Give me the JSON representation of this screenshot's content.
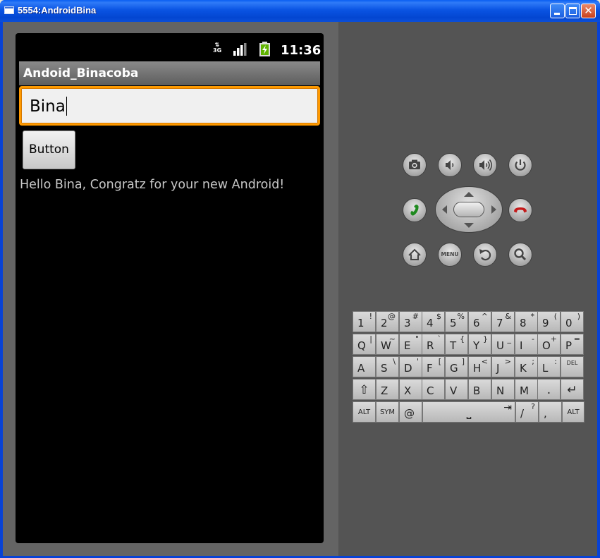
{
  "window": {
    "title": "5554:AndroidBina",
    "minimize_icon": "minimize-icon",
    "maximize_icon": "maximize-icon",
    "close_icon": "close-icon",
    "close_glyph": "✕"
  },
  "status_bar": {
    "network_type": "3G",
    "time": "11:36"
  },
  "app": {
    "title": "Andoid_Binacoba",
    "input_value": "Bina",
    "button_label": "Button",
    "greeting": "Hello Bina, Congratz for your new Android!"
  },
  "controls": {
    "menu_label": "MENU"
  },
  "keyboard": {
    "rows": [
      [
        {
          "main": "1",
          "alt": "!"
        },
        {
          "main": "2",
          "alt": "@"
        },
        {
          "main": "3",
          "alt": "#"
        },
        {
          "main": "4",
          "alt": "$"
        },
        {
          "main": "5",
          "alt": "%"
        },
        {
          "main": "6",
          "alt": "^"
        },
        {
          "main": "7",
          "alt": "&"
        },
        {
          "main": "8",
          "alt": "*"
        },
        {
          "main": "9",
          "alt": "("
        },
        {
          "main": "0",
          "alt": ")"
        }
      ],
      [
        {
          "main": "Q",
          "alt": "|"
        },
        {
          "main": "W",
          "alt": "~"
        },
        {
          "main": "E",
          "alt": "\""
        },
        {
          "main": "R",
          "alt": "`"
        },
        {
          "main": "T",
          "alt": "{"
        },
        {
          "main": "Y",
          "alt": "}"
        },
        {
          "main": "U",
          "alt": "_"
        },
        {
          "main": "I",
          "alt": "-"
        },
        {
          "main": "O",
          "alt": "+"
        },
        {
          "main": "P",
          "alt": "="
        }
      ],
      [
        {
          "main": "A",
          "alt": ""
        },
        {
          "main": "S",
          "alt": "\\"
        },
        {
          "main": "D",
          "alt": "'"
        },
        {
          "main": "F",
          "alt": "["
        },
        {
          "main": "G",
          "alt": "]"
        },
        {
          "main": "H",
          "alt": "<"
        },
        {
          "main": "J",
          "alt": ">"
        },
        {
          "main": "K",
          "alt": ";"
        },
        {
          "main": "L",
          "alt": ":"
        },
        {
          "main": "DEL",
          "alt": ""
        }
      ],
      [
        {
          "main": "⇧",
          "alt": ""
        },
        {
          "main": "Z",
          "alt": ""
        },
        {
          "main": "X",
          "alt": ""
        },
        {
          "main": "C",
          "alt": ""
        },
        {
          "main": "V",
          "alt": ""
        },
        {
          "main": "B",
          "alt": ""
        },
        {
          "main": "N",
          "alt": ""
        },
        {
          "main": "M",
          "alt": ""
        },
        {
          "main": ".",
          "alt": ""
        },
        {
          "main": "↵",
          "alt": ""
        }
      ]
    ],
    "bottom_row": {
      "alt_left": "ALT",
      "sym": "SYM",
      "at": "@",
      "space_glyph": "⎵",
      "tab_glyph": "⇥",
      "slash": "/",
      "question": "?",
      "comma": ",",
      "alt_right": "ALT"
    }
  }
}
